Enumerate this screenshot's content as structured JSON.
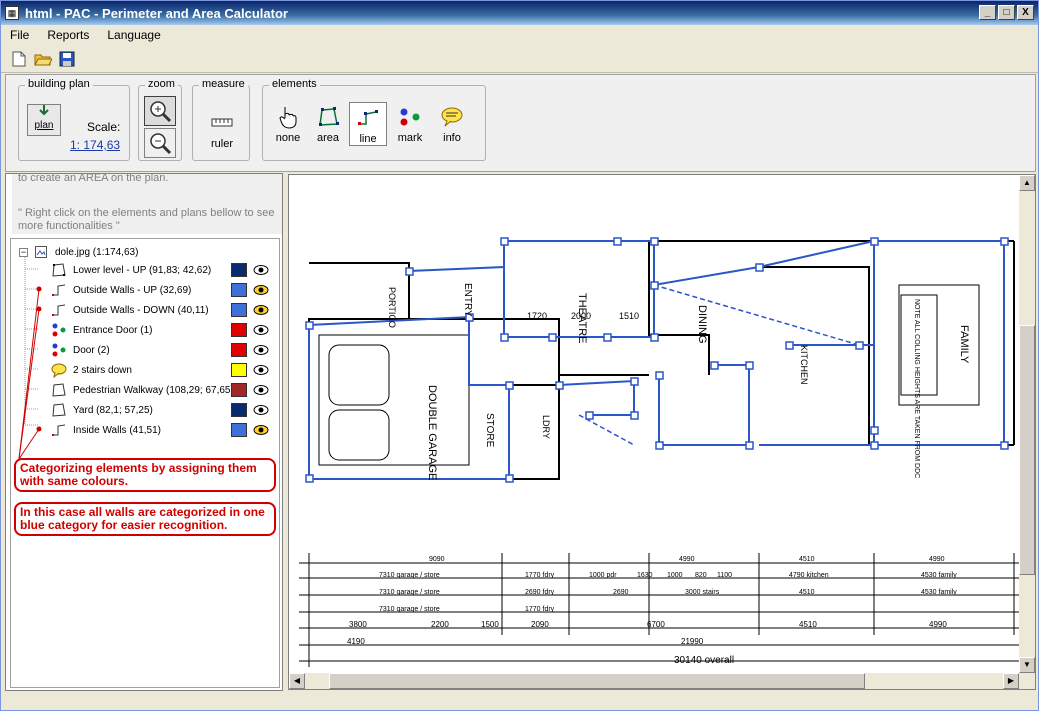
{
  "window": {
    "title": "html - PAC - Perimeter and Area Calculator",
    "controls": [
      "_",
      "□",
      "X"
    ]
  },
  "menu": [
    "File",
    "Reports",
    "Language"
  ],
  "ribbon": {
    "building_plan": {
      "label": "building plan",
      "plan_button": "plan",
      "scale_label": "Scale:",
      "scale_value": "1: 174,63"
    },
    "zoom": {
      "label": "zoom"
    },
    "measure": {
      "label": "measure",
      "ruler": "ruler"
    },
    "elements": {
      "label": "elements",
      "none": "none",
      "area": "area",
      "line": "line",
      "mark": "mark",
      "info": "info"
    }
  },
  "hint": {
    "line1": "to create an AREA on the plan.",
    "line2": "\" Right click on the elements and plans bellow to see more functionalities \""
  },
  "tree": {
    "root": "dole.jpg (1:174,63)",
    "items": [
      {
        "label": "Lower level - UP (91,83; 42,62)",
        "color": "#0a2a6e",
        "eye": "open"
      },
      {
        "label": "Outside Walls - UP (32,69)",
        "color": "#3f6fd8",
        "eye": "yellow"
      },
      {
        "label": "Outside Walls - DOWN (40,11)",
        "color": "#3f6fd8",
        "eye": "yellow"
      },
      {
        "label": "Entrance Door (1)",
        "color": "#e00000",
        "eye": "open"
      },
      {
        "label": "Door (2)",
        "color": "#e00000",
        "eye": "open"
      },
      {
        "label": "2 stairs down",
        "color": "#ffff00",
        "eye": "open"
      },
      {
        "label": "Pedestrian Walkway (108,29; 67,65)",
        "color": "#a02828",
        "eye": "open"
      },
      {
        "label": "Yard (82,1; 57,25)",
        "color": "#0a2a6e",
        "eye": "open"
      },
      {
        "label": "Inside Walls (41,51)",
        "color": "#3f6fd8",
        "eye": "yellow"
      }
    ]
  },
  "callouts": {
    "one": "Categorizing elements by assigning them with same colours.",
    "two": "In this case all walls are categorized in one blue category for easier recognition."
  },
  "plan": {
    "rooms": [
      "THEATRE",
      "DINING",
      "FAMILY",
      "DOUBLE GARAGE",
      "STORE",
      "ENTRY",
      "PORTICO",
      "KITCHEN",
      "LDRY"
    ],
    "note": "NOTE ALL COLLING HEIGHTS ARE TAKEN FROM DDC",
    "dims_top": [
      "1720",
      "2000",
      "1510"
    ],
    "dim_rows": {
      "row1": [
        "9090",
        "4990",
        "4510",
        "4990"
      ],
      "row2": [
        "7310 garage / store",
        "1770 fdry",
        "1000 pdr",
        "1630",
        "1000",
        "820",
        "1100",
        "4790 kitchen",
        "4530 family"
      ],
      "row3": [
        "7310 garage / store",
        "2690 fdry",
        "2690",
        "3000 stairs",
        "4510",
        "4530 family"
      ],
      "row4": [
        "7310 garage / store",
        "1770 fdry"
      ],
      "row5": [
        "3800",
        "2200",
        "1500",
        "2090",
        "6700",
        "4510",
        "4990"
      ],
      "row6": [
        "4190",
        "21990"
      ],
      "overall": "30140 overall"
    }
  },
  "colors": {
    "accent_blue": "#2a56c8",
    "callout_red": "#d00000"
  }
}
